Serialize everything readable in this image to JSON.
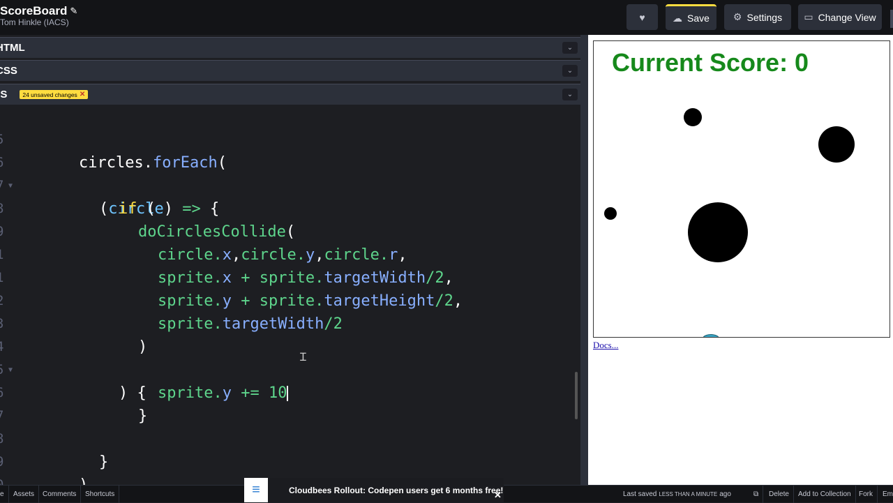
{
  "header": {
    "title": "ScoreBoard",
    "author": "Tom Hinkle (IACS)",
    "save_label": "Save",
    "settings_label": "Settings",
    "change_view_label": "Change View"
  },
  "panels": {
    "html_label": "HTML",
    "css_label": "CSS",
    "js_label": "JS",
    "unsaved_badge": "24 unsaved changes"
  },
  "code_lines": [
    {
      "num": "5",
      "text": "circles.forEach("
    },
    {
      "num": "6",
      "text": "(circle) => {"
    },
    {
      "num": "7",
      "text": "if ("
    },
    {
      "num": "8",
      "text": "doCirclesCollide("
    },
    {
      "num": "9",
      "text": "circle.x,circle.y,circle.r,"
    },
    {
      "num": "1",
      "text": "sprite.x + sprite.targetWidth/2,"
    },
    {
      "num": "1",
      "text": "sprite.y + sprite.targetHeight/2,"
    },
    {
      "num": "2",
      "text": "sprite.targetWidth/2"
    },
    {
      "num": "3",
      "text": ")"
    },
    {
      "num": "4",
      "text": ") {"
    },
    {
      "num": "5",
      "text": "sprite.y += 10"
    },
    {
      "num": "6",
      "text": "}"
    },
    {
      "num": "7",
      "text": ""
    },
    {
      "num": "8",
      "text": "}"
    },
    {
      "num": "9",
      "text": ")"
    },
    {
      "num": "0",
      "text": ""
    }
  ],
  "preview": {
    "score_text": "Current Score: 0",
    "docs_link": "Docs..."
  },
  "footer": {
    "items": [
      "e",
      "Assets",
      "Comments",
      "Shortcuts"
    ],
    "ad_text": "Cloudbees Rollout: Codepen users get 6 months free!",
    "last_saved_prefix": "Last saved",
    "last_saved_time": "LESS THAN A MINUTE",
    "last_saved_suffix": "ago",
    "delete_label": "Delete",
    "add_collection_label": "Add to Collection",
    "fork_label": "Fork",
    "embed_label": "Em"
  },
  "icons": {
    "heart": "heart-icon",
    "cloud": "cloud-icon",
    "gear": "gear-icon",
    "view": "view-icon",
    "pencil": "pencil-icon",
    "chevron": "chevron-down-icon"
  },
  "colors": {
    "accent": "#ffdd40",
    "score_green": "#16891b"
  }
}
